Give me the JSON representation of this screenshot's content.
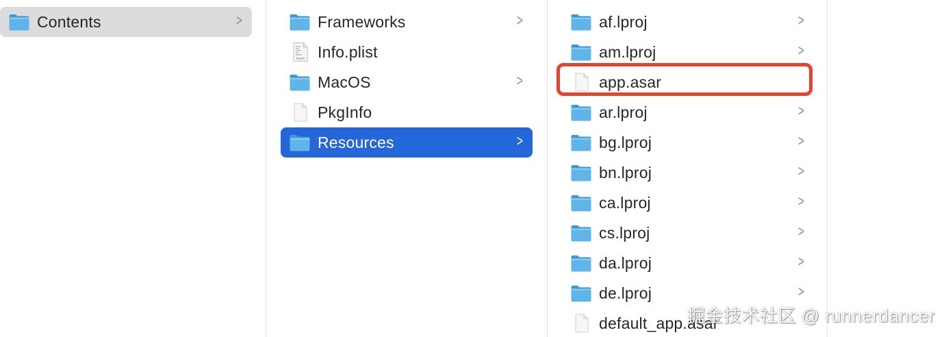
{
  "columns": [
    {
      "items": [
        {
          "label": "Contents",
          "icon": "folder-icon",
          "has_children": true,
          "state": "selected-gray"
        }
      ]
    },
    {
      "items": [
        {
          "label": "Frameworks",
          "icon": "folder-icon",
          "has_children": true,
          "state": "normal"
        },
        {
          "label": "Info.plist",
          "icon": "plist-file-icon",
          "has_children": false,
          "state": "normal"
        },
        {
          "label": "MacOS",
          "icon": "folder-icon",
          "has_children": true,
          "state": "normal"
        },
        {
          "label": "PkgInfo",
          "icon": "document-icon",
          "has_children": false,
          "state": "normal"
        },
        {
          "label": "Resources",
          "icon": "folder-icon",
          "has_children": true,
          "state": "selected-blue"
        }
      ]
    },
    {
      "items": [
        {
          "label": "af.lproj",
          "icon": "folder-icon",
          "has_children": true,
          "state": "normal"
        },
        {
          "label": "am.lproj",
          "icon": "folder-icon",
          "has_children": true,
          "state": "normal"
        },
        {
          "label": "app.asar",
          "icon": "document-icon",
          "has_children": false,
          "state": "highlighted"
        },
        {
          "label": "ar.lproj",
          "icon": "folder-icon",
          "has_children": true,
          "state": "normal"
        },
        {
          "label": "bg.lproj",
          "icon": "folder-icon",
          "has_children": true,
          "state": "normal"
        },
        {
          "label": "bn.lproj",
          "icon": "folder-icon",
          "has_children": true,
          "state": "normal"
        },
        {
          "label": "ca.lproj",
          "icon": "folder-icon",
          "has_children": true,
          "state": "normal"
        },
        {
          "label": "cs.lproj",
          "icon": "folder-icon",
          "has_children": true,
          "state": "normal"
        },
        {
          "label": "da.lproj",
          "icon": "folder-icon",
          "has_children": true,
          "state": "normal"
        },
        {
          "label": "de.lproj",
          "icon": "folder-icon",
          "has_children": true,
          "state": "normal"
        },
        {
          "label": "default_app.asar",
          "icon": "document-icon",
          "has_children": false,
          "state": "normal"
        }
      ]
    },
    {
      "items": []
    }
  ],
  "chevron_glyph": ">",
  "plist_badge": "PLIST",
  "watermark": "掘金技术社区 @ runnerdancer",
  "colors": {
    "folder": "#5fb4ea",
    "folder_dark": "#3f98d6",
    "selection_blue": "#2367d8",
    "selection_gray": "#dcdcdc",
    "highlight_red": "#e8422f"
  }
}
